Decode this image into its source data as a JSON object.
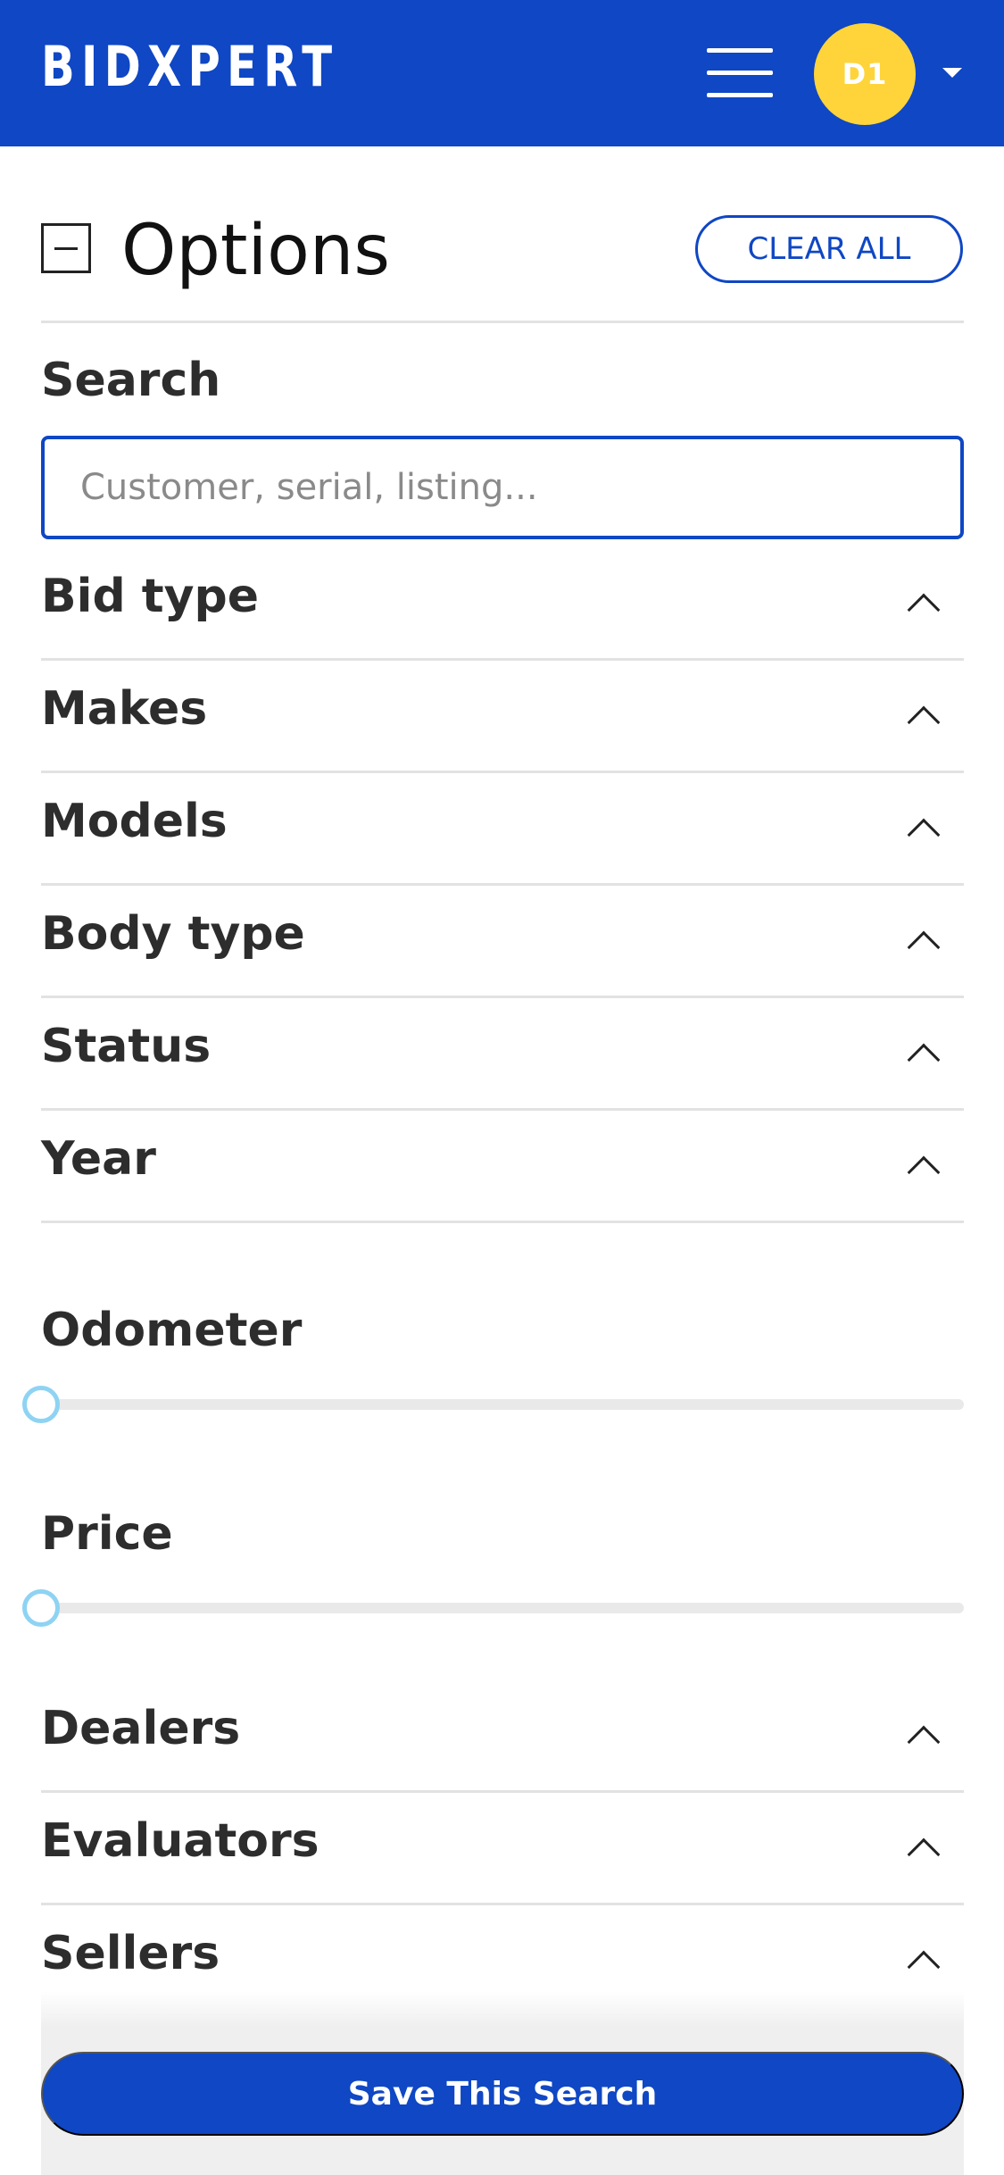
{
  "header": {
    "logo": "BIDXPERT",
    "avatar_initials": "D1"
  },
  "options": {
    "title": "Options",
    "clear_all_label": "CLEAR ALL"
  },
  "search": {
    "label": "Search",
    "placeholder": "Customer, serial, listing..."
  },
  "filters_top": [
    {
      "label": "Bid type"
    },
    {
      "label": "Makes"
    },
    {
      "label": "Models"
    },
    {
      "label": "Body type"
    },
    {
      "label": "Status"
    },
    {
      "label": "Year"
    }
  ],
  "odometer": {
    "label": "Odometer",
    "value": 0
  },
  "price": {
    "label": "Price",
    "value": 0
  },
  "filters_bottom": [
    {
      "label": "Dealers"
    },
    {
      "label": "Evaluators"
    },
    {
      "label": "Sellers"
    }
  ],
  "footer": {
    "save_label": "Save This Search"
  },
  "colors": {
    "brand_blue": "#0f47c4",
    "avatar_yellow": "#fed43a",
    "slider_thumb": "#8ed3f3"
  }
}
